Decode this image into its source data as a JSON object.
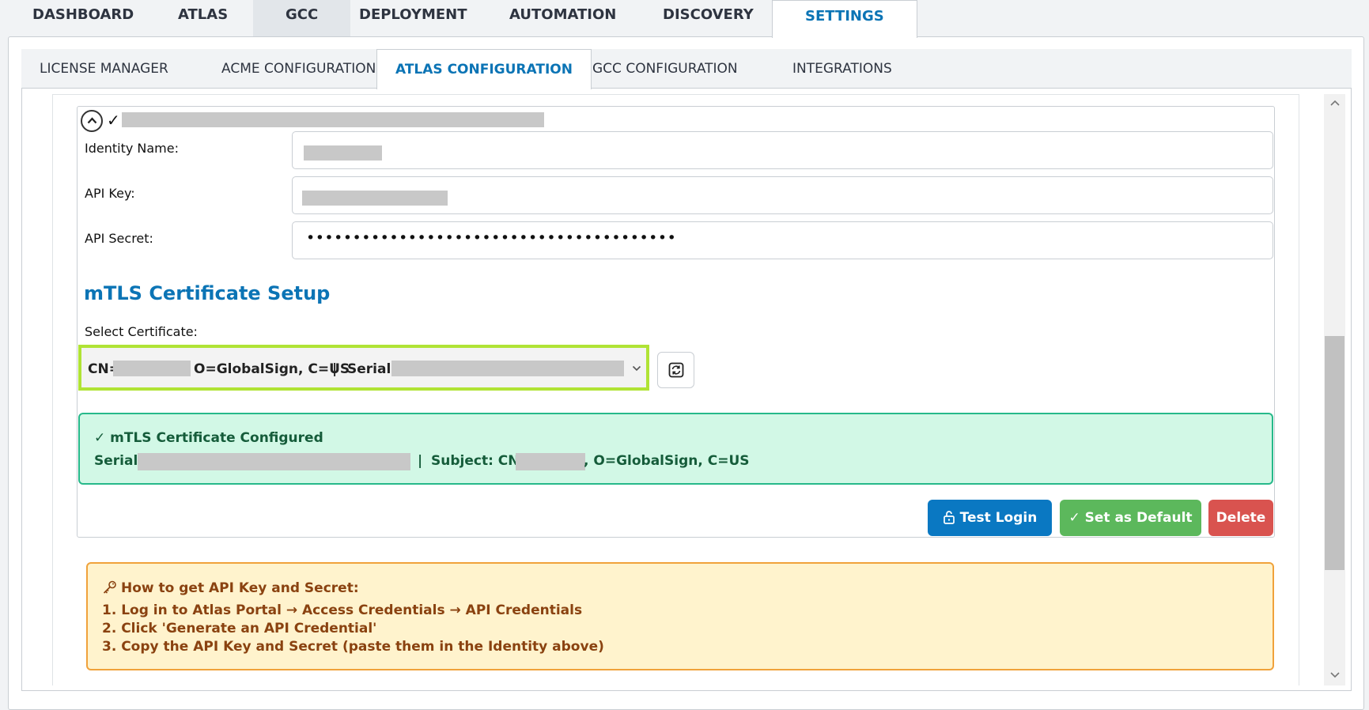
{
  "top_nav": {
    "tabs": [
      {
        "label": "DASHBOARD"
      },
      {
        "label": "ATLAS"
      },
      {
        "label": "GCC"
      },
      {
        "label": "DEPLOYMENT"
      },
      {
        "label": "AUTOMATION"
      },
      {
        "label": "DISCOVERY"
      },
      {
        "label": "SETTINGS"
      }
    ],
    "active": "SETTINGS"
  },
  "sub_nav": {
    "tabs": [
      {
        "label": "LICENSE MANAGER"
      },
      {
        "label": "ACME CONFIGURATION"
      },
      {
        "label": "ATLAS CONFIGURATION"
      },
      {
        "label": "GCC CONFIGURATION"
      },
      {
        "label": "INTEGRATIONS"
      }
    ],
    "active": "ATLAS CONFIGURATION"
  },
  "identity": {
    "check": "✓",
    "fields": {
      "identity_name_label": "Identity Name:",
      "api_key_label": "API Key:",
      "api_secret_label": "API Secret:",
      "api_secret_value": "••••••••••••••••••••••••••••••••••••••••"
    },
    "mtls": {
      "title": "mTLS Certificate Setup",
      "select_label": "Select Certificate:",
      "selected_prefix": "CN=",
      "selected_org": "O=GlobalSign, C=US",
      "selected_separator": "|",
      "selected_serial_prefix": "Serial="
    },
    "status": {
      "title": "✓ mTLS Certificate Configured",
      "serial_label": "Serial:",
      "separator": "|",
      "subject_label": "Subject: CN=",
      "subject_rest": ", O=GlobalSign, C=US"
    },
    "buttons": {
      "test_login": "Test Login",
      "set_default": "✓ Set as Default",
      "delete": "Delete"
    }
  },
  "help": {
    "title": "How to get API Key and Secret:",
    "steps": [
      "1. Log in to Atlas Portal → Access Credentials → API Credentials",
      "2. Click 'Generate an API Credential'",
      "3. Copy the API Key and Secret (paste them in the Identity above)"
    ]
  },
  "colors": {
    "accent": "#0b74b5",
    "success_bg": "#d2f8e6",
    "success_border": "#27b98a",
    "warning_bg": "#fff3cd",
    "warning_border": "#f0a23b",
    "highlight": "#b0e335",
    "primary_button": "#0a78c2",
    "default_button": "#5cb85c",
    "delete_button": "#d9534f"
  }
}
